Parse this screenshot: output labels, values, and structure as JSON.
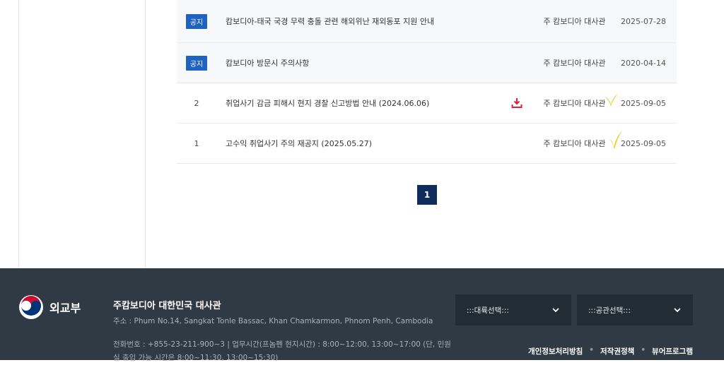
{
  "notices": [
    {
      "badge": "공지",
      "title": "캄보디아-태국 국경 무력 충돌 관련 해외위난 재외동포 지원 안내",
      "writer": "주 캄보디아 대사관",
      "date": "2025-07-28"
    },
    {
      "badge": "공지",
      "title": "캄보디아 방문시 주의사항",
      "writer": "주 캄보디아 대사관",
      "date": "2020-04-14"
    }
  ],
  "posts": [
    {
      "num": "2",
      "title": "취업사기 감금 피해시 현지 경찰 신고방법 안내 (2024.06.06)",
      "writer": "주 캄보디아 대사관",
      "date": "2025-09-05",
      "has_file": true
    },
    {
      "num": "1",
      "title": "고수익 취업사기 주의 재공지 (2025.05.27)",
      "writer": "주 캄보디아 대사관",
      "date": "2025-09-05",
      "has_file": false
    }
  ],
  "pagination": {
    "current": "1"
  },
  "footer": {
    "logo_text": "외교부",
    "embassy": "주캄보디아 대한민국 대사관",
    "address": "주소 : Phum No.14, Sangkat Tonle Bassac, Khan Chamkarmon, Phnom Penh, Cambodia",
    "phone": "전화번호 : +855-23-211-900~3 | 업무시간(프놈펜 현지시간) : 8:00~12:00, 13:00~17:00 (단, 민원실 출입 가능 시간은 8:00~11:30, 13:00~15:30)",
    "select_continent": ":::대륙선택:::",
    "select_mission": ":::공관선택:::",
    "links": [
      "개인정보처리방침",
      "저작권정책",
      "뷰어프로그램"
    ]
  },
  "colors": {
    "badge": "#1e62c2",
    "pager": "#0f2d5c",
    "footer_bg": "#2f3a44",
    "check": "#f2c200",
    "file_icon": "#d9233a"
  }
}
